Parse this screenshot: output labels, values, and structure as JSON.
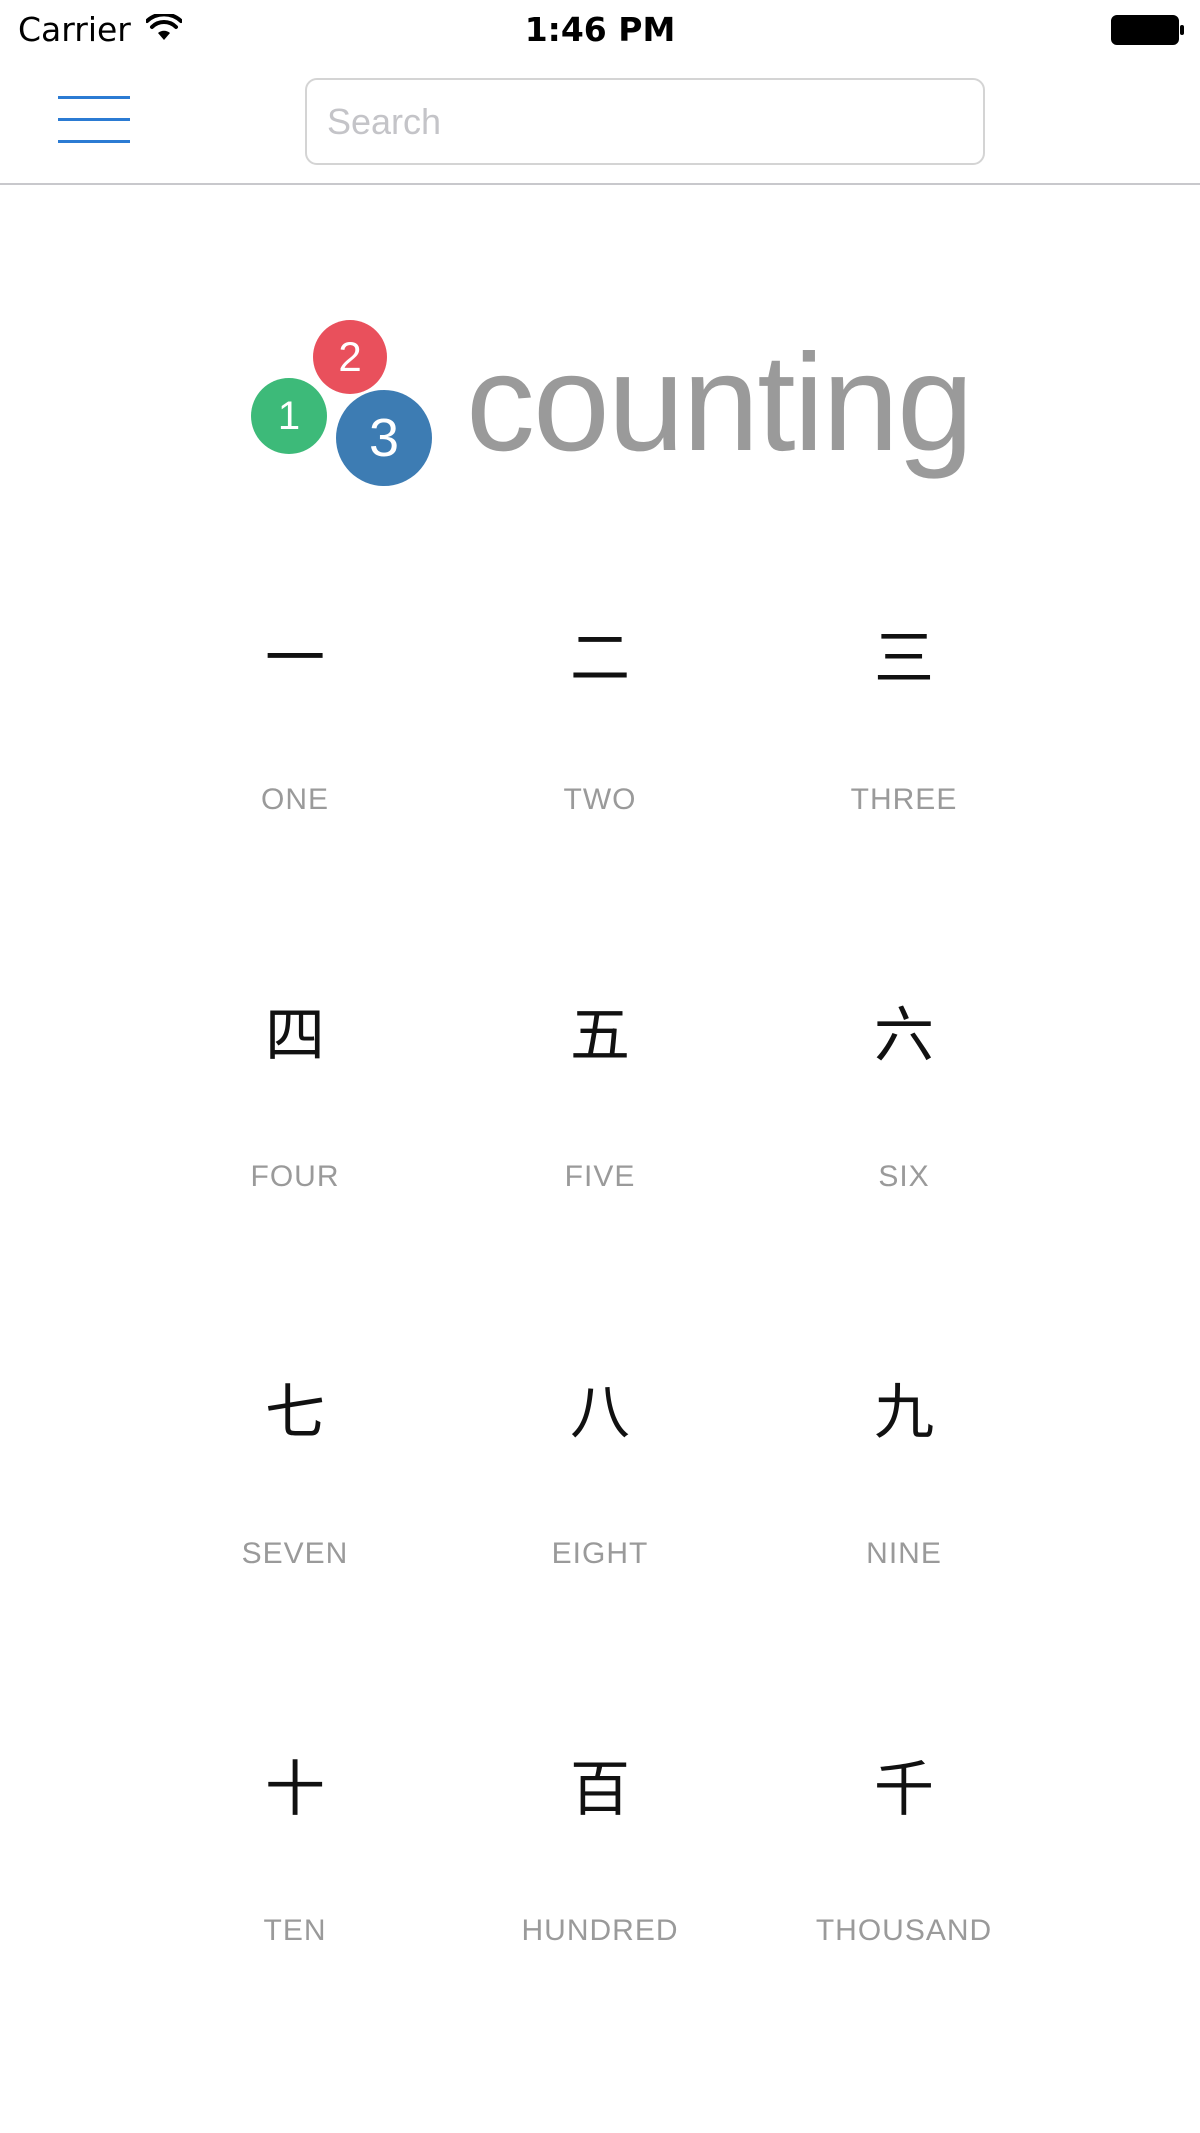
{
  "status_bar": {
    "carrier": "Carrier",
    "time": "1:46 PM"
  },
  "nav": {
    "search_placeholder": "Search",
    "search_value": ""
  },
  "logo": {
    "ball_1": "1",
    "ball_2": "2",
    "ball_3": "3",
    "text": "counting",
    "colors": {
      "ball_1": "#3dba79",
      "ball_2": "#e9505c",
      "ball_3": "#3d7cb3",
      "text": "#9a9a9a"
    }
  },
  "accent_color": "#2b7bd3",
  "numbers": [
    {
      "kanji": "一",
      "label": "ONE"
    },
    {
      "kanji": "二",
      "label": "TWO"
    },
    {
      "kanji": "三",
      "label": "THREE"
    },
    {
      "kanji": "四",
      "label": "FOUR"
    },
    {
      "kanji": "五",
      "label": "FIVE"
    },
    {
      "kanji": "六",
      "label": "SIX"
    },
    {
      "kanji": "七",
      "label": "SEVEN"
    },
    {
      "kanji": "八",
      "label": "EIGHT"
    },
    {
      "kanji": "九",
      "label": "NINE"
    },
    {
      "kanji": "十",
      "label": "TEN"
    },
    {
      "kanji": "百",
      "label": "HUNDRED"
    },
    {
      "kanji": "千",
      "label": "THOUSAND"
    }
  ]
}
